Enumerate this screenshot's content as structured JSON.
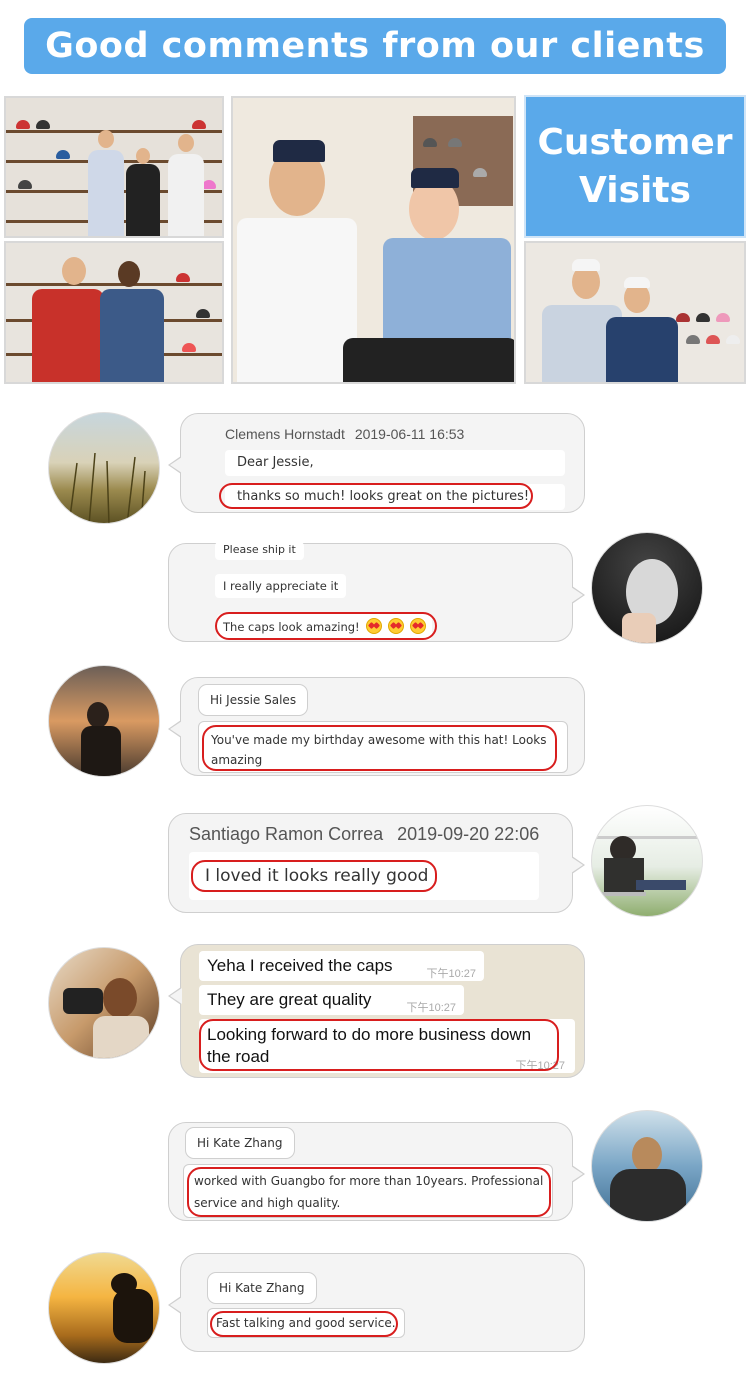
{
  "banner": {
    "title": "Good comments from our clients"
  },
  "customer_visits": {
    "line1": "Customer",
    "line2": "Visits"
  },
  "reviews": [
    {
      "sender": "Clemens Hornstadt",
      "date": "2019-06-11 16:53",
      "messages": [
        "Dear Jessie,",
        "thanks so much! looks great on the pictures!"
      ]
    },
    {
      "messages": [
        "Please ship it",
        "I really appreciate it",
        "The caps look amazing!"
      ],
      "emoji_count": 3
    },
    {
      "greeting": "Hi Jessie Sales",
      "messages": [
        "You've made my birthday awesome with this hat! Looks",
        "amazing"
      ]
    },
    {
      "sender": "Santiago Ramon Correa",
      "date": "2019-09-20 22:06",
      "messages": [
        "I loved it looks really good"
      ]
    },
    {
      "messages": [
        {
          "text": "Yeha I received the caps",
          "time": "下午10:27"
        },
        {
          "text": "They are great quality",
          "time": "下午10:27"
        },
        {
          "text": "Looking forward to do more business down",
          "text2": "the road",
          "time": "下午10:27"
        }
      ]
    },
    {
      "greeting": "Hi Kate Zhang",
      "messages": [
        "worked with Guangbo for more than 10years. Professional",
        "service and high quality."
      ]
    },
    {
      "greeting": "Hi Kate Zhang",
      "messages": [
        "Fast talking and good service."
      ]
    }
  ],
  "colors": {
    "banner": "#5aa9ea",
    "highlight": "#d81e1e",
    "bubble": "#f4f4f4"
  }
}
